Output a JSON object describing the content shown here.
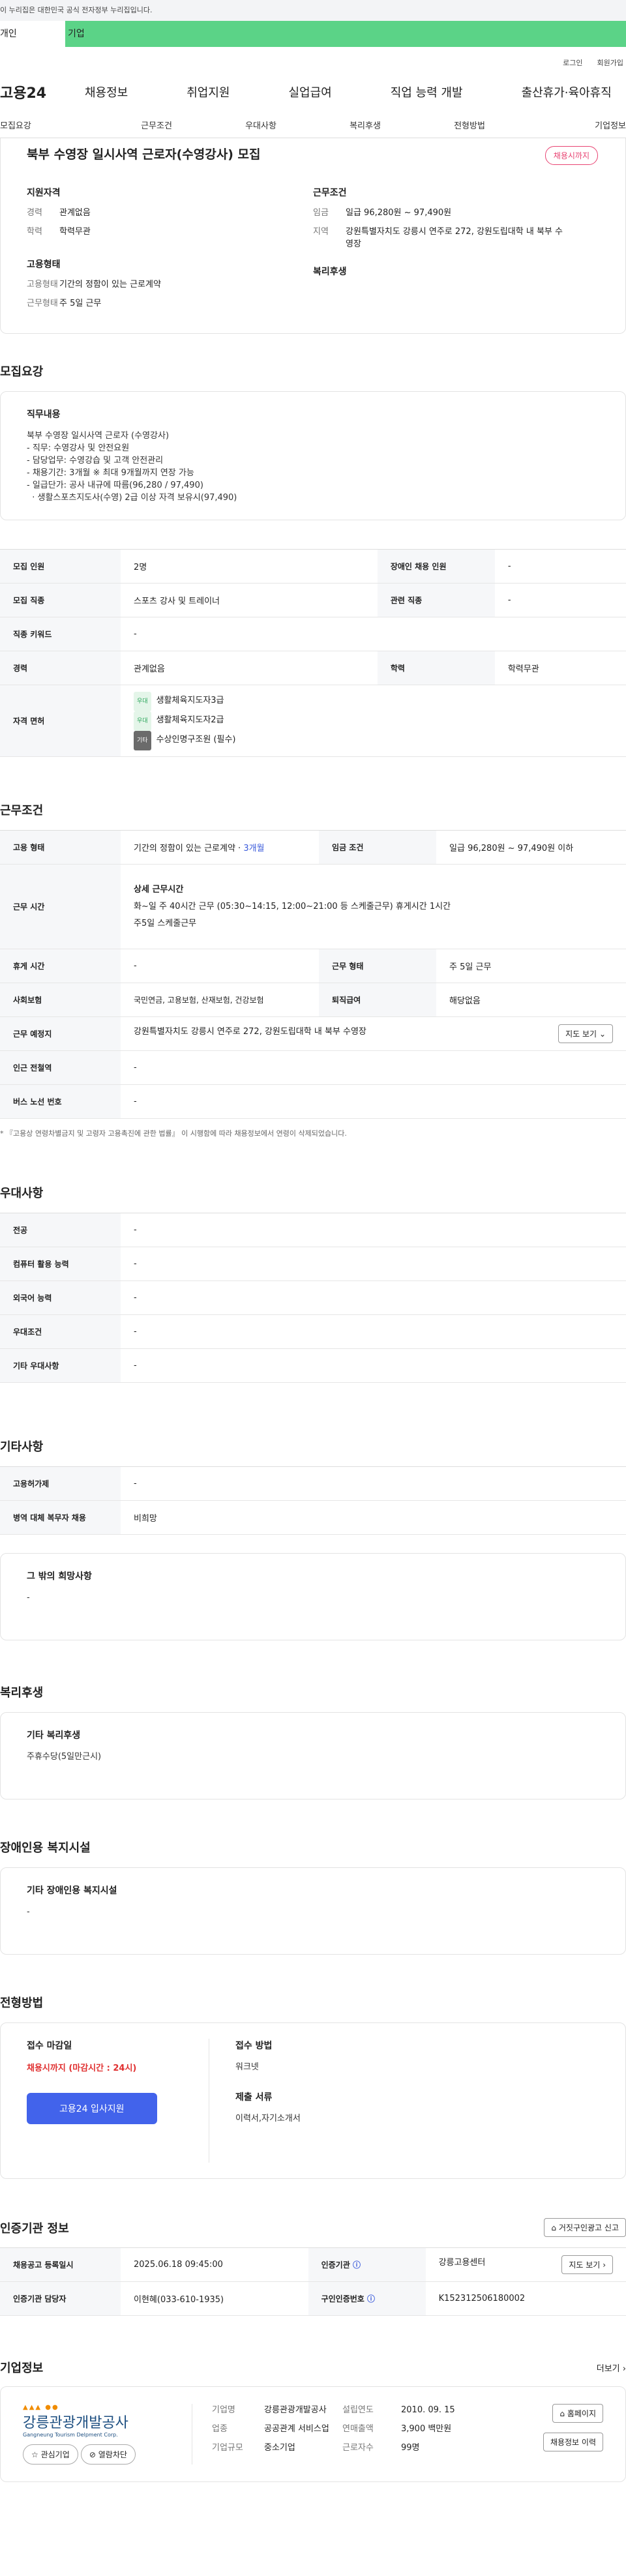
{
  "gov_bar": "이 누리집은 대한민국 공식 전자정부 누리집입니다.",
  "service_tabs": [
    "개인",
    "기업"
  ],
  "util_links": [
    "로그인",
    "회원가입"
  ],
  "gnb": {
    "logo": "고용24",
    "menus": [
      "채용정보",
      "취업지원",
      "실업급여",
      "직업 능력 개발",
      "출산휴가·육아휴직"
    ]
  },
  "tabs": [
    "모집요강",
    "근무조건",
    "우대사항",
    "복리후생",
    "전형방법",
    "기업정보"
  ],
  "header": {
    "title": "북부 수영장 일시사역 근로자(수영강사) 모집",
    "badge": "채용시까지",
    "qual_title": "지원자격",
    "career_k": "경력",
    "career_v": "관계없음",
    "edu_k": "학력",
    "edu_v": "학력무관",
    "cond_title": "근무조건",
    "wage_k": "임금",
    "wage_v": "일급 96,280원 ~ 97,490원",
    "loc_k": "지역",
    "loc_v": "강원특별자치도 강릉시 연주로 272, 강원도립대학 내 북부 수영장",
    "emp_title": "고용형태",
    "emptype_k": "고용형태",
    "emptype_v": "기간의 정함이 있는 근로계약",
    "worktype_k": "근무형태",
    "worktype_v": "주 5일 근무",
    "welfare_title": "복리후생"
  },
  "recruit": {
    "section": "모집요강",
    "duty_title": "직무내용",
    "duty_lines": [
      "북부 수영장 일시사역 근로자 (수영강사)",
      "- 직무: 수영강사 및 안전요원",
      "- 담당업무: 수영강습 및 고객 안전관리",
      "- 채용기간: 3개월 ※ 최대 9개월까지 연장 가능",
      "- 일급단가: 공사 내규에 따름(96,280 / 97,490)",
      "  · 생활스포츠지도사(수영) 2급 이상 자격 보유시(97,490)"
    ],
    "rows": {
      "count_k": "모집 인원",
      "count_v": "2명",
      "dis_k": "장애인 채용 인원",
      "dis_v": "-",
      "job_k": "모집 직종",
      "job_v": "스포츠 강사 및 트레이너",
      "rel_k": "관련 직종",
      "rel_v": "-",
      "kw_k": "직종 키워드",
      "kw_v": "-",
      "career_k": "경력",
      "career_v": "관계없음",
      "edu_k": "학력",
      "edu_v": "학력무관",
      "lic_k": "자격 면허"
    },
    "licenses": [
      {
        "tag": "우대",
        "name": "생활체육지도자3급"
      },
      {
        "tag": "우대",
        "name": "생활체육지도자2급"
      },
      {
        "tag": "기타",
        "name": "수상인명구조원 (필수)"
      }
    ]
  },
  "cond": {
    "section": "근무조건",
    "emp_k": "고용 형태",
    "emp_v": "기간의 정함이 있는 근로계약 · ",
    "emp_period": "3개월",
    "wage_k": "임금 조건",
    "wage_v": "일급 96,280원 ~ 97,490원 이하",
    "time_k": "근무 시간",
    "time_title": "상세 근무시간",
    "time_l1": "화~일 주 40시간 근무 (05:30~14:15, 12:00~21:00 등 스케줄근무) 휴게시간 1시간",
    "time_l2": "주5일 스케줄근무",
    "rest_k": "휴게 시간",
    "rest_v": "-",
    "form_k": "근무 형태",
    "form_v": "주 5일 근무",
    "ins_k": "사회보험",
    "ins_v": "국민연금, 고용보험, 산재보험, 건강보험",
    "ret_k": "퇴직급여",
    "ret_v": "해당없음",
    "place_k": "근무 예정지",
    "place_v": "강원특별자치도 강릉시 연주로 272, 강원도립대학 내 북부 수영장",
    "map_btn": "지도 보기",
    "sub_k": "인근 전철역",
    "sub_v": "-",
    "bus_k": "버스 노선 번호",
    "bus_v": "-",
    "note": "* 『고용상 연령차별금지 및 고령자 고용촉진에 관한 법률』 이 시행함에 따라 채용정보에서 연령이 삭제되었습니다."
  },
  "pref": {
    "section": "우대사항",
    "rows": [
      {
        "k": "전공",
        "v": "-"
      },
      {
        "k": "컴퓨터 활용 능력",
        "v": "-"
      },
      {
        "k": "외국어 능력",
        "v": "-"
      },
      {
        "k": "우대조건",
        "v": "-"
      },
      {
        "k": "기타 우대사항",
        "v": "-"
      }
    ]
  },
  "etc": {
    "section": "기타사항",
    "ins_k": "고용허가제",
    "ins_v": "-",
    "mil_k": "병역 대체 복무자 채용",
    "mil_v": "비희망",
    "hope_title": "그 밖의 희망사항",
    "hope_v": "-"
  },
  "welfare": {
    "section": "복리후생",
    "title": "기타 복리후생",
    "v": "주휴수당(5일만근시)"
  },
  "disab": {
    "section": "장애인용 복지시설",
    "title": "기타 장애인용 복지시설",
    "v": "-"
  },
  "process": {
    "section": "전형방법",
    "deadline_k": "접수 마감일",
    "deadline_v": "채용시까지 (마감시간 : 24시)",
    "method_k": "접수 방법",
    "method_v": "워크넷",
    "apply_btn": "고용24 입사지원",
    "docs_k": "제출 서류",
    "docs_v": "이력서,자기소개서"
  },
  "agency": {
    "section": "인증기관 정보",
    "report_btn": "거짓구인광고 신고",
    "reg_k": "채용공고 등록일시",
    "reg_v": "2025.06.18 09:45:00",
    "org_k": "인증기관",
    "org_v": "강릉고용센터",
    "dir_btn": "지도 보기",
    "staff_k": "인증기관 담당자",
    "staff_v": "이현혜(033-610-1935)",
    "no_k": "구인인증번호",
    "no_v": "K152312506180002"
  },
  "company": {
    "section": "기업정보",
    "more": "더보기",
    "logo_ko": "강릉관광개발공사",
    "logo_en": "Gangneung Tourism Delpment Corp.",
    "fav": "관심기업",
    "block": "열람차단",
    "name_k": "기업명",
    "name_v": "강릉관광개발공사",
    "ind_k": "업종",
    "ind_v": "공공관계 서비스업",
    "size_k": "기업규모",
    "size_v": "중소기업",
    "est_k": "설립연도",
    "est_v": "2010. 09. 15",
    "sales_k": "연매출액",
    "sales_v": "3,900 백만원",
    "emp_k": "근로자수",
    "emp_v": "99명",
    "home_btn": "홈페이지",
    "info_btn": "채용정보 이력"
  },
  "colors": {
    "accent": "#4263eb",
    "green": "#5bd387",
    "badge": "#e84372"
  }
}
